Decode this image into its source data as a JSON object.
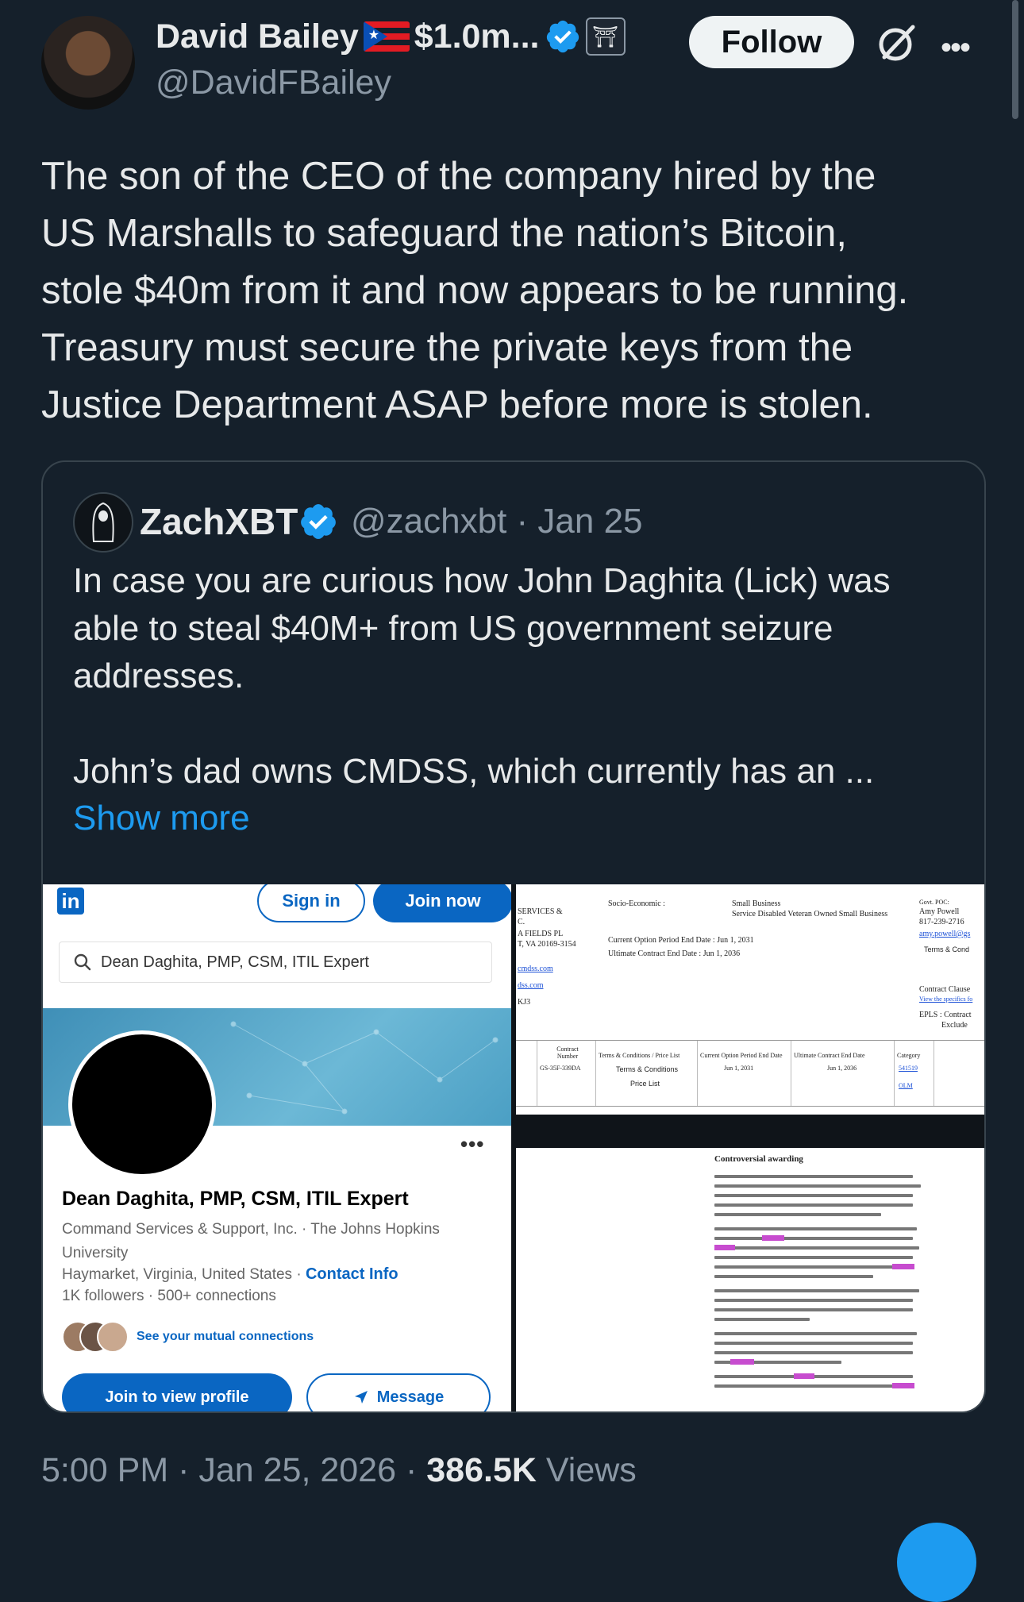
{
  "author": {
    "display_name": "David Bailey",
    "name_suffix": "$1.0m...",
    "handle": "@DavidFBailey",
    "follow_label": "Follow"
  },
  "tweet": {
    "text": "The son of the CEO of the company hired by the\nUS Marshalls to safeguard the nation’s Bitcoin,\nstole $40m from it and now appears to be running.\nTreasury must secure the private keys from the\nJustice Department ASAP before more is stolen."
  },
  "quote": {
    "name": "ZachXBT",
    "handle": "@zachxbt",
    "separator": " · ",
    "date": "Jan 25",
    "text": "In case you are curious how John Daghita (Lick) was\nable to steal $40M+ from US government seizure\naddresses.\n\nJohn’s dad owns CMDSS, which currently has an ...",
    "show_more": "Show more"
  },
  "linkedin": {
    "logo": "in",
    "sign_in": "Sign in",
    "join_now": "Join now",
    "search_value": "Dean Daghita, PMP, CSM, ITIL Expert",
    "profile_name": "Dean Daghita, PMP, CSM, ITIL Expert",
    "company_line": "Command Services & Support, Inc.  ·  The Johns Hopkins University",
    "location": "Haymarket, Virginia, United States",
    "dot": " · ",
    "contact_info": "Contact Info",
    "followers": "1K followers",
    "connections": "500+ connections",
    "mutual": "See your mutual connections",
    "join_view": "Join to view profile",
    "message": "Message"
  },
  "document": {
    "services": "SERVICES &",
    "c": "C.",
    "address1": "A FIELDS PL",
    "address2": "T, VA 20169-3154",
    "link1": "cmdss.com",
    "link2": "dss.com",
    "code": "KJ3",
    "socio": "Socio-Economic :",
    "small_business": "Small Business",
    "sdvosb": "Service Disabled Veteran Owned Small Business",
    "poc_label": "Govt. POC:",
    "poc_name": "Amy Powell",
    "poc_phone": "817-239-2716",
    "poc_email": "amy.powell@gs",
    "terms_cond": "Terms & Cond",
    "current_end": "Current Option Period End Date : Jun 1, 2031",
    "ultimate_end": "Ultimate Contract End Date :     Jun 1, 2036",
    "contract_clause": "Contract Clause",
    "view_specifics": "View the specifics fo",
    "epls": "EPLS : Contract",
    "excluded": "Exclude",
    "th_contract": "Contract Number",
    "th_terms": "Terms & Conditions / Price List",
    "th_current": "Current Option Period End Date",
    "th_ultimate": "Ultimate Contract End Date",
    "th_category": "Category",
    "td_number": "GS-35F-339DA",
    "td_terms": "Terms & Conditions",
    "td_price": "Price List",
    "td_current": "Jun 1, 2031",
    "td_ultimate": "Jun 1, 2036",
    "td_cat1": "541519",
    "td_cat2": "OLM",
    "article_heading": "Controversial awarding"
  },
  "footer": {
    "time": "5:00 PM",
    "dot": " · ",
    "date": "Jan 25, 2026",
    "views_count": "386.5K",
    "views_label": " Views"
  },
  "icons": {
    "verified": "verified-badge-icon",
    "org": "government-affiliation-icon",
    "grok": "grok-icon",
    "more": "more-icon"
  },
  "colors": {
    "background": "#15202b",
    "accent": "#1d9bf0",
    "linkedin": "#0a66c2"
  }
}
